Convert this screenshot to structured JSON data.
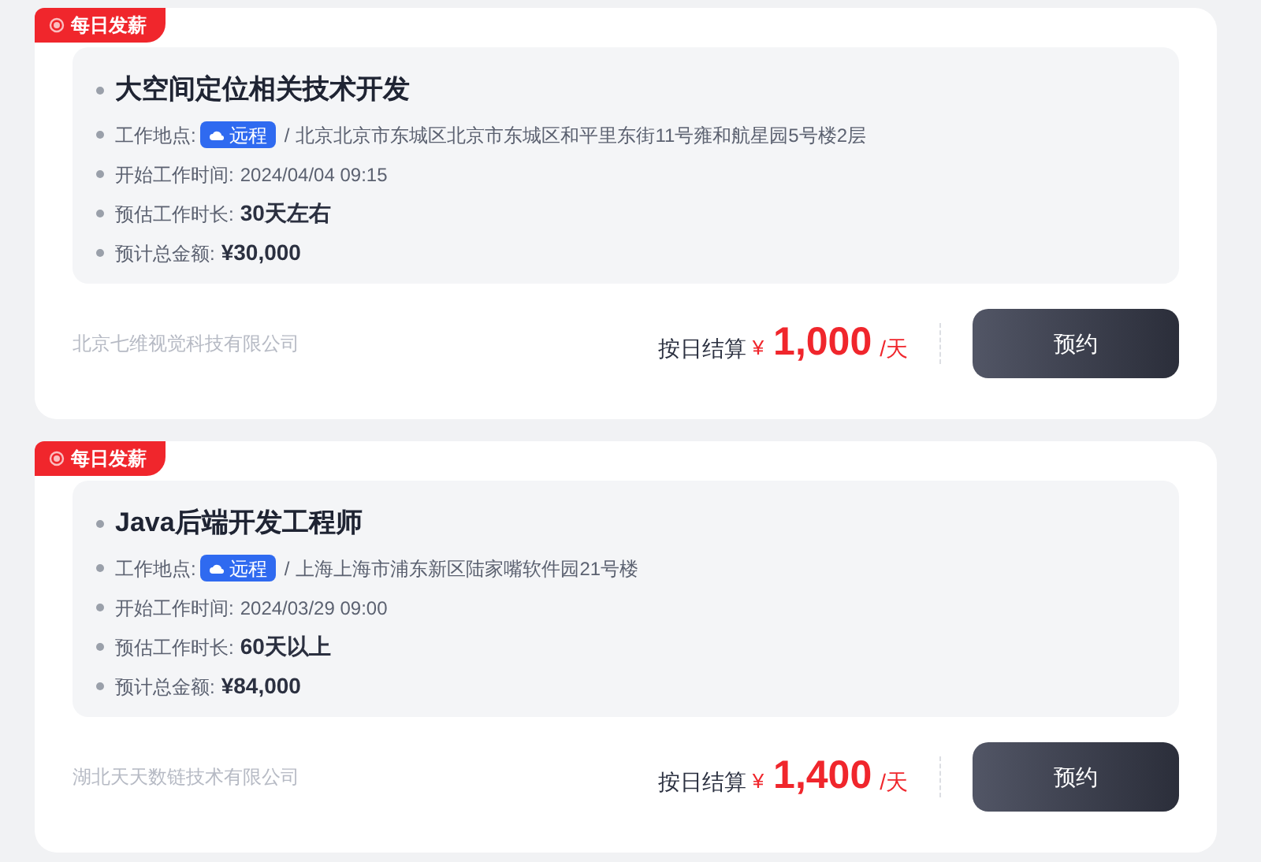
{
  "jobs": [
    {
      "badge": "每日发薪",
      "title": "大空间定位相关技术开发",
      "location_label": "工作地点:",
      "location_tag": "远程",
      "separator": "/",
      "address": "北京北京市东城区北京市东城区和平里东街11号雍和航星园5号楼2层",
      "start_label": "开始工作时间:",
      "start_value": "2024/04/04 09:15",
      "duration_label": "预估工作时长:",
      "duration_value": "30天左右",
      "total_label": "预计总金额:",
      "total_value": "¥30,000",
      "company": "北京七维视觉科技有限公司",
      "settle_label": "按日结算",
      "currency": "¥",
      "amount": "1,000",
      "unit": "/天",
      "button": "预约"
    },
    {
      "badge": "每日发薪",
      "title": "Java后端开发工程师",
      "location_label": "工作地点:",
      "location_tag": "远程",
      "separator": "/",
      "address": "上海上海市浦东新区陆家嘴软件园21号楼",
      "start_label": "开始工作时间:",
      "start_value": "2024/03/29 09:00",
      "duration_label": "预估工作时长:",
      "duration_value": "60天以上",
      "total_label": "预计总金额:",
      "total_value": "¥84,000",
      "company": "湖北天天数链技术有限公司",
      "settle_label": "按日结算",
      "currency": "¥",
      "amount": "1,400",
      "unit": "/天",
      "button": "预约"
    }
  ]
}
